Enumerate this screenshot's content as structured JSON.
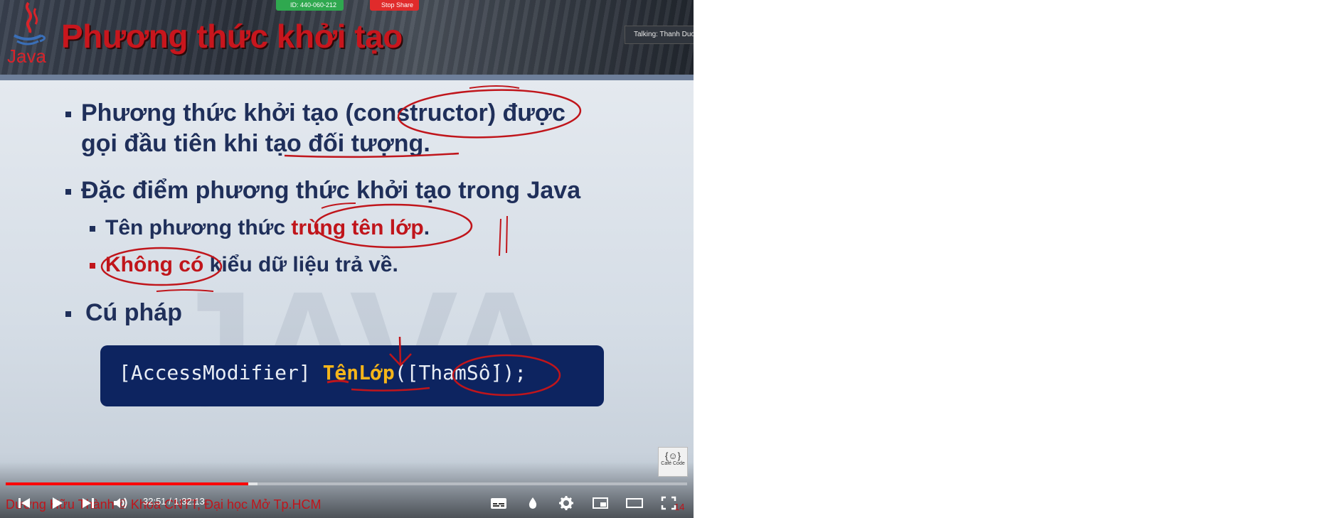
{
  "slide": {
    "title": "Phương thức khởi tạo",
    "logo_text": "Java",
    "bullets": {
      "b1_line1": "Phương thức khởi tạo (constructor) được",
      "b1_line2": "gọi đầu tiên khi tạo đối tượng.",
      "b2": "Đặc điểm phương thức khởi tạo trong Java",
      "b2a_pre": "Tên phương thức ",
      "b2a_red": "trùng tên lớp",
      "b2a_post": ".",
      "b2b_red": "Không có",
      "b2b_post": " kiểu dữ liệu trả về.",
      "b3": "Cú pháp"
    },
    "code": {
      "part1": "[AccessModifier] ",
      "name": "TênLớp",
      "part2": "([ThamSố]);"
    },
    "watermark": "JAVA",
    "caption": "Dương Hữu Thành  ©  Khoa CNTT, Đại học Mở Tp.HCM",
    "slide_number": "14",
    "cafe_logo": {
      "glyph": "{☺}",
      "name": "Café Code"
    }
  },
  "meeting": {
    "meeting_id": "ID: 440-060-212",
    "stop_share_label": "Stop Share",
    "talking_label": "Talking: Thanh Duong"
  },
  "player": {
    "current_time": "32:51",
    "duration": "1:32:13",
    "time_display": "32:51 / 1:32:13",
    "progress_fraction": 0.356,
    "buffered_fraction": 0.37,
    "colors": {
      "progress": "#ff0000",
      "title": "#c8161d",
      "code_bg": "#0d2460",
      "code_name": "#f5b51a"
    },
    "icons": [
      "previous-icon",
      "play-icon",
      "next-icon",
      "volume-icon",
      "subtitles-icon",
      "ambient-icon",
      "settings-icon",
      "miniplayer-icon",
      "theater-icon",
      "fullscreen-icon"
    ]
  }
}
